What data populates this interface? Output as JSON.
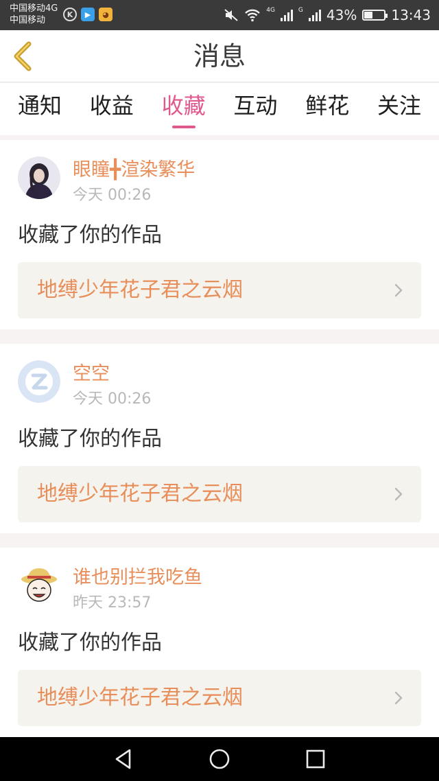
{
  "status_bar": {
    "carrier_line1": "中国移动4G",
    "carrier_line2": "中国移动",
    "battery": "43%",
    "battery_level": 0.43,
    "time": "13:43",
    "network_label_1": "4G",
    "network_label_2": "G",
    "icons": [
      "k-app-icon",
      "video-app-icon",
      "cat-app-icon",
      "mute-icon",
      "wifi-icon",
      "signal-icon",
      "battery-icon"
    ]
  },
  "header": {
    "title": "消息",
    "back_icon": "back-chevron-icon"
  },
  "tabs": [
    {
      "label": "通知",
      "active": false
    },
    {
      "label": "收益",
      "active": false
    },
    {
      "label": "收藏",
      "active": true
    },
    {
      "label": "互动",
      "active": false
    },
    {
      "label": "鲜花",
      "active": false
    },
    {
      "label": "关注",
      "active": false
    }
  ],
  "messages": [
    {
      "user": "眼瞳╋渲染繁华",
      "time": "今天 00:26",
      "action": "收藏了你的作品",
      "work": "地缚少年花子君之云烟",
      "avatar": "girl-photo-avatar"
    },
    {
      "user": "空空",
      "time": "今天 00:26",
      "action": "收藏了你的作品",
      "work": "地缚少年花子君之云烟",
      "avatar": "default-z-avatar"
    },
    {
      "user": "谁也别拦我吃鱼",
      "time": "昨天 23:57",
      "action": "收藏了你的作品",
      "work": "地缚少年花子君之云烟",
      "avatar": "straw-hat-avatar"
    }
  ],
  "colors": {
    "accent": "#e0598e",
    "name_orange": "#e88e5a",
    "work_box_bg": "#f5f3ee"
  },
  "navbar": {
    "icons": [
      "back-triangle-icon",
      "home-circle-icon",
      "recent-square-icon"
    ]
  }
}
